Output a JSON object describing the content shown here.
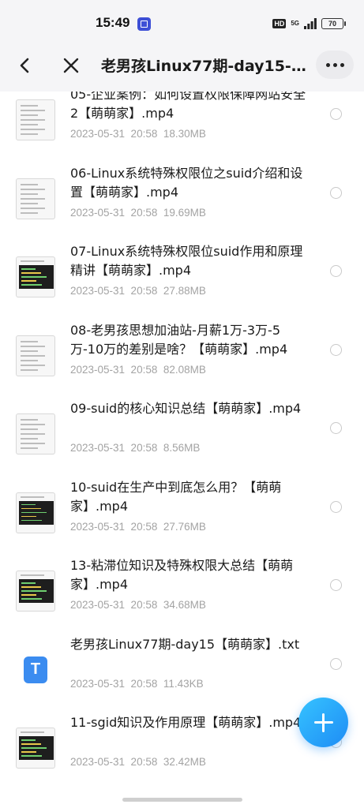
{
  "status_bar": {
    "time": "15:49",
    "hd": "HD",
    "network": "5G",
    "battery": "70"
  },
  "nav": {
    "title": "老男孩Linux77期-day15-Li…"
  },
  "files": [
    {
      "name": "05-企业案例：如何设置权限保障网站安全2【萌萌家】.mp4",
      "date": "2023-05-31  20:58",
      "size": "18.30MB",
      "thumb": "doc"
    },
    {
      "name": "06-Linux系统特殊权限位之suid介绍和设置【萌萌家】.mp4",
      "date": "2023-05-31  20:58",
      "size": "19.69MB",
      "thumb": "doc"
    },
    {
      "name": "07-Linux系统特殊权限位suid作用和原理精讲【萌萌家】.mp4",
      "date": "2023-05-31  20:58",
      "size": "27.88MB",
      "thumb": "terminal"
    },
    {
      "name": "08-老男孩思想加油站-月薪1万-3万-5万-10万的差别是啥？【萌萌家】.mp4",
      "date": "2023-05-31  20:58",
      "size": "82.08MB",
      "thumb": "doc"
    },
    {
      "name": "09-suid的核心知识总结【萌萌家】.mp4",
      "date": "2023-05-31  20:58",
      "size": "8.56MB",
      "thumb": "doc"
    },
    {
      "name": "10-suid在生产中到底怎么用？【萌萌家】.mp4",
      "date": "2023-05-31  20:58",
      "size": "27.76MB",
      "thumb": "terminal"
    },
    {
      "name": "13-粘滞位知识及特殊权限大总结【萌萌家】.mp4",
      "date": "2023-05-31  20:58",
      "size": "34.68MB",
      "thumb": "terminal"
    },
    {
      "name": "老男孩Linux77期-day15【萌萌家】.txt",
      "date": "2023-05-31  20:58",
      "size": "11.43KB",
      "thumb": "txt",
      "icon_letter": "T"
    },
    {
      "name": "11-sgid知识及作用原理【萌萌家】.mp4",
      "date": "2023-05-31  20:58",
      "size": "32.42MB",
      "thumb": "terminal"
    }
  ],
  "colors": {
    "accent": "#1e8cf5",
    "meta_text": "#a3a3a3",
    "txt_icon": "#3b8cf0"
  },
  "icons": {
    "back": "chevron-left-icon",
    "close": "close-icon",
    "more": "more-horizontal-icon",
    "fab": "plus-icon"
  }
}
